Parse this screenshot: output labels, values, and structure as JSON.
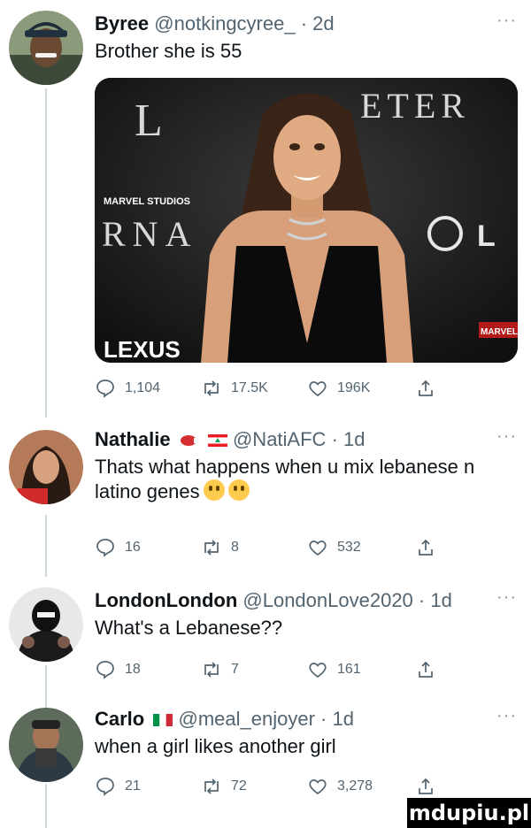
{
  "tweets": [
    {
      "name": "Byree",
      "handle": "@notkingcyree_",
      "time": "2d",
      "text": "Brother she is 55",
      "replies": "1,104",
      "retweets": "17.5K",
      "likes": "196K",
      "avatar_icon": "person-avatar-icon"
    },
    {
      "name": "Nathalie",
      "handle": "@NatiAFC",
      "time": "1d",
      "text": "Thats what happens when u mix lebanese n latino genes",
      "replies": "16",
      "retweets": "8",
      "likes": "532",
      "badges": [
        "boxing-glove-icon",
        "lebanon-flag-icon"
      ]
    },
    {
      "name": "LondonLondon",
      "handle": "@LondonLove2020",
      "time": "1d",
      "text": "What's a Lebanese??",
      "replies": "18",
      "retweets": "7",
      "likes": "161"
    },
    {
      "name": "Carlo",
      "handle": "@meal_enjoyer",
      "time": "1d",
      "text": "when a girl likes another girl",
      "replies": "21",
      "retweets": "72",
      "likes": "3,278",
      "badges": [
        "italy-flag-icon"
      ]
    }
  ],
  "media": {
    "backdrop_text_top": "L",
    "backdrop_text_right": "ETER",
    "backdrop_text_left": "RNA",
    "studio_text": "MARVEL STUDIOS",
    "sponsor_text": "LEXUS",
    "marvel_tag": "MARVEL S"
  },
  "watermark": "mdupiu.pl",
  "colors": {
    "line": "#cfd9de",
    "muted": "#536471",
    "text": "#0f1419"
  }
}
